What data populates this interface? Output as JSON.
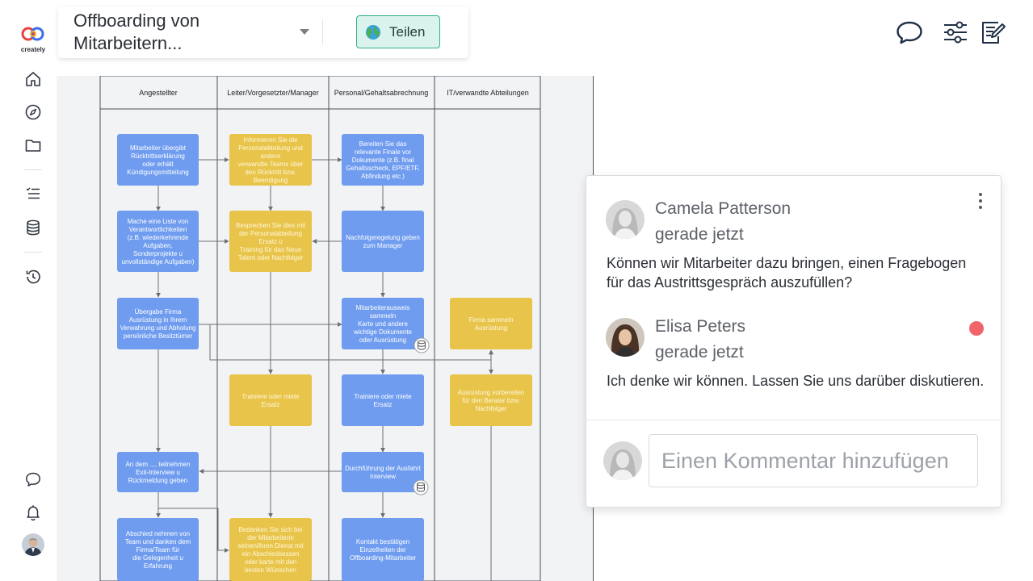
{
  "app": {
    "logo_text": "creately",
    "document_title": "Offboarding von Mitarbeitern...",
    "share_label": "Teilen"
  },
  "icons": {
    "rail": [
      "home-icon",
      "explore-icon",
      "folder-icon",
      "tasks-icon",
      "database-icon",
      "history-icon",
      "chat-icon",
      "bell-icon"
    ],
    "top": [
      "comments-icon",
      "settings-sliders-icon",
      "edit-notes-icon"
    ]
  },
  "diagram": {
    "lanes": [
      "Angestellter",
      "Leiter/Vorgesetzter/Manager",
      "Personal/Gehaltsabrechnung",
      "IT/verwandte Abteilungen"
    ],
    "nodes": [
      {
        "id": "n1",
        "lines": [
          "Mitarbeiter übergibt",
          "Rücktrittserklärung",
          "oder erhält",
          "Kündigungsmitteilung"
        ]
      },
      {
        "id": "n2",
        "lines": [
          "Informieren Sie die",
          "Personalabteilung und",
          "andere",
          "verwandte Teams über",
          "den Rücktritt bzw.",
          "Beendigung"
        ]
      },
      {
        "id": "n3",
        "lines": [
          "Bereiten Sie das",
          "relevante Finale vor",
          "Dokumente (z.B. final",
          "Gehaltsscheck, EPF/ETF,",
          "Abfindung etc.)"
        ]
      },
      {
        "id": "n4",
        "lines": [
          "Mache eine Liste von",
          "Verantwortlichkeiten",
          "(z.B. wiederkehrende",
          "Aufgaben,",
          "Sonderprojekte u",
          "unvollständige Aufgaben)"
        ]
      },
      {
        "id": "n5",
        "lines": [
          "Besprechen Sie dies mit",
          "der Personalabteilung",
          "Ersatz u",
          "Training für das Neue",
          "Talent oder Nachfolger"
        ]
      },
      {
        "id": "n6",
        "lines": [
          "Nachfolgeregelung geben",
          "zum Manager"
        ]
      },
      {
        "id": "n7",
        "lines": [
          "Übergabe Firma",
          "Ausrüstung in Ihrem",
          "Verwahrung und Abholung",
          "persönliche Besitztümer"
        ]
      },
      {
        "id": "n8",
        "lines": [
          "Mitarbeiterausweis",
          "sammeln",
          "Karte und andere",
          "wichtige Dokumente",
          "oder Ausrüstung"
        ]
      },
      {
        "id": "n9",
        "lines": [
          "Firma sammeln",
          "Ausrüstung"
        ]
      },
      {
        "id": "n10",
        "lines": [
          "Trainiere oder miete",
          "Ersatz"
        ]
      },
      {
        "id": "n11",
        "lines": [
          "Trainiere oder miete",
          "Ersatz"
        ]
      },
      {
        "id": "n12",
        "lines": [
          "Ausrüstung vorbereiten",
          "für den Berater bzw.",
          "Nachfolger"
        ]
      },
      {
        "id": "n13",
        "lines": [
          "An dem ..., teilnehmen",
          "Exit-Interview u",
          "Rückmeldung geben"
        ]
      },
      {
        "id": "n14",
        "lines": [
          "Durchführung der Ausfahrt",
          "Interview"
        ]
      },
      {
        "id": "n15",
        "lines": [
          "Abschied nehmen von",
          "Team und danken dem",
          "Firma/Team für",
          "die Gelegenheit u",
          "Erfahrung"
        ]
      },
      {
        "id": "n16",
        "lines": [
          "Bedanken Sie sich bei",
          "der Mitarbeiterin",
          "seinen/ihren Dienst mit",
          "ein Abschiedsessen",
          "oder karte mit den",
          "besten Wünschen"
        ]
      },
      {
        "id": "n17",
        "lines": [
          "Kontakt bestätigen",
          "Einzelheiten der",
          "Offboarding-Mitarbeiter"
        ]
      }
    ]
  },
  "comments": {
    "items": [
      {
        "author": "Camela Patterson",
        "time": "gerade jetzt",
        "text": "Können wir Mitarbeiter dazu bringen, einen Fragebogen für das Austrittsgespräch auszufüllen?"
      },
      {
        "author": "Elisa Peters",
        "time": "gerade jetzt",
        "text": "Ich denke wir können. Lassen Sie uns darüber diskutieren."
      }
    ],
    "input_placeholder": "Einen Kommentar hinzufügen"
  },
  "colors": {
    "blue_node": "#6f9cef",
    "yellow_node": "#e8c44a",
    "share_bg": "#daf3ec",
    "share_border": "#2fb08a",
    "unread": "#f0646a",
    "canvas": "#f2f3f5"
  }
}
